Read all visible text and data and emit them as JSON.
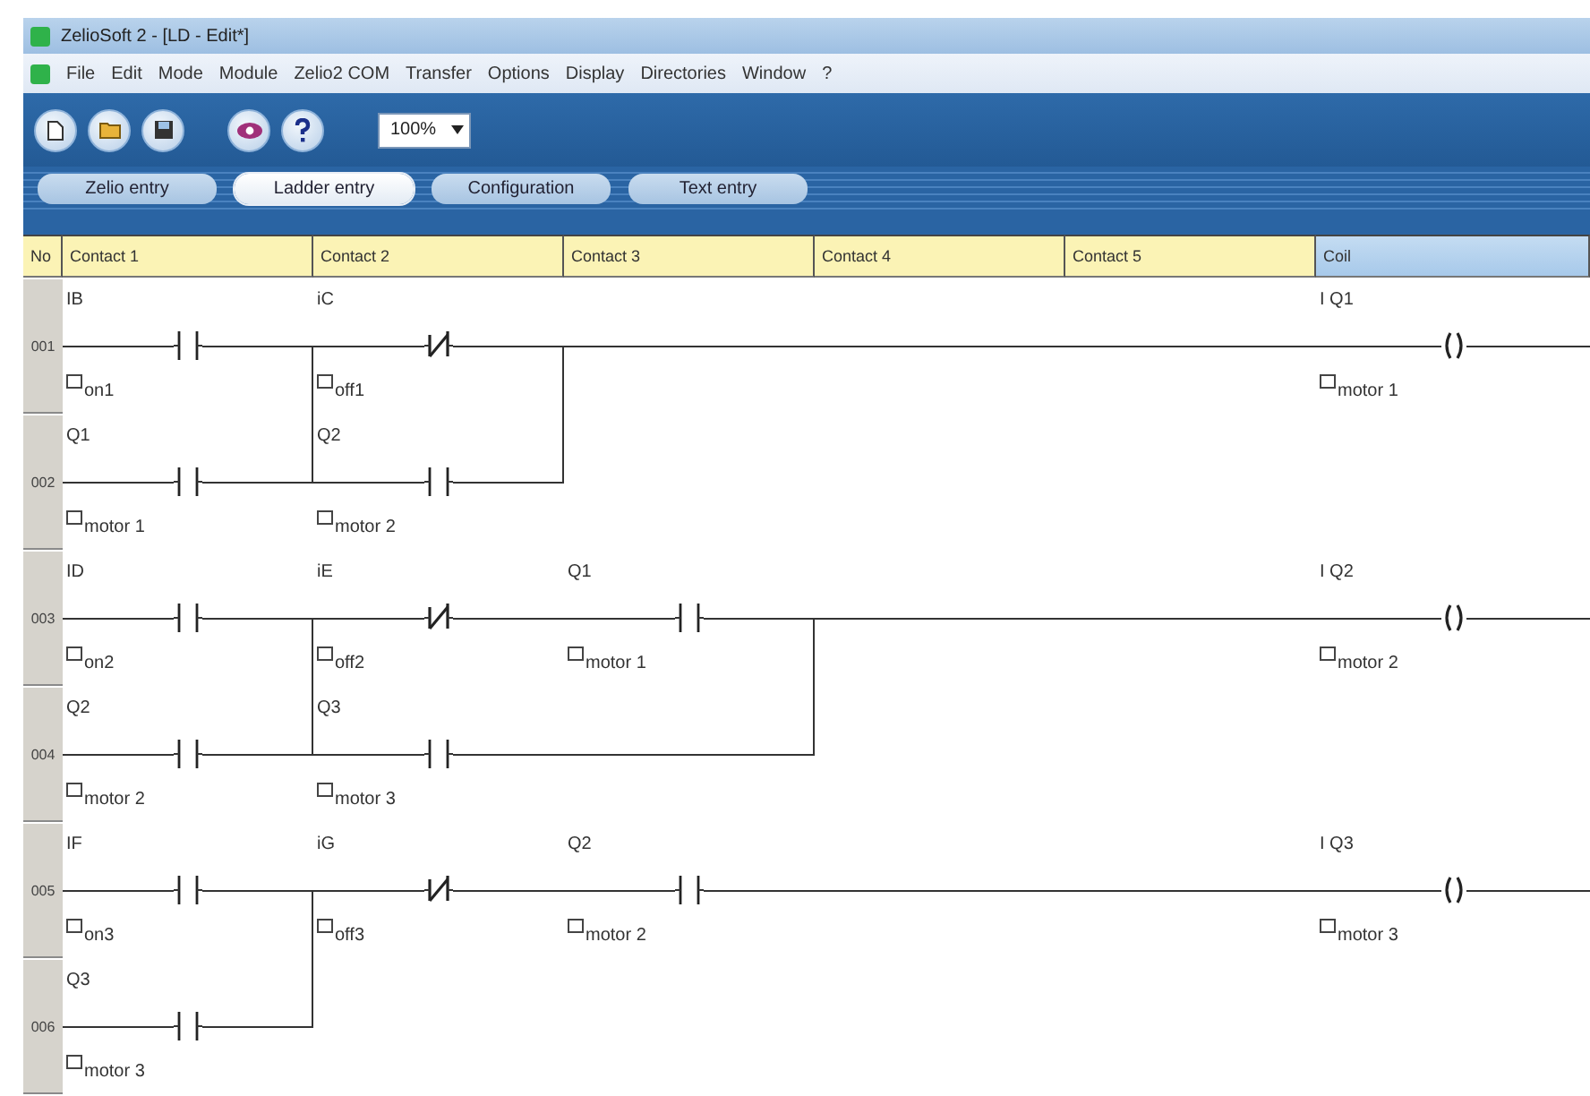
{
  "window": {
    "title": "ZelioSoft 2 - [LD - Edit*]"
  },
  "menu": [
    "File",
    "Edit",
    "Mode",
    "Module",
    "Zelio2 COM",
    "Transfer",
    "Options",
    "Display",
    "Directories",
    "Window",
    "?"
  ],
  "toolbar": {
    "zoom": "100%"
  },
  "tabs": [
    {
      "label": "Zelio entry",
      "selected": false
    },
    {
      "label": "Ladder entry",
      "selected": true
    },
    {
      "label": "Configuration",
      "selected": false
    },
    {
      "label": "Text entry",
      "selected": false
    }
  ],
  "columns": [
    {
      "label": "No",
      "selected": false
    },
    {
      "label": "Contact 1",
      "selected": false
    },
    {
      "label": "Contact 2",
      "selected": false
    },
    {
      "label": "Contact 3",
      "selected": false
    },
    {
      "label": "Contact 4",
      "selected": false
    },
    {
      "label": "Contact 5",
      "selected": false
    },
    {
      "label": "Coil",
      "selected": true
    }
  ],
  "rows": [
    {
      "number": "001",
      "cells": [
        {
          "kind": "no",
          "address": "IB",
          "comment": "on1"
        },
        {
          "kind": "nc",
          "address": "iC",
          "comment": "off1"
        },
        {
          "kind": "wire"
        },
        {
          "kind": "wire"
        },
        {
          "kind": "wire"
        },
        {
          "kind": "coil",
          "address": "I Q1",
          "comment": "motor 1"
        }
      ]
    },
    {
      "number": "002",
      "cells": [
        {
          "kind": "no",
          "address": "Q1",
          "comment": "motor 1",
          "link_up": true
        },
        {
          "kind": "no",
          "address": "Q2",
          "comment": "motor 2",
          "link_up": true
        },
        {
          "kind": "empty"
        },
        {
          "kind": "empty"
        },
        {
          "kind": "empty"
        },
        {
          "kind": "empty"
        }
      ]
    },
    {
      "number": "003",
      "cells": [
        {
          "kind": "no",
          "address": "ID",
          "comment": "on2"
        },
        {
          "kind": "nc",
          "address": "iE",
          "comment": "off2"
        },
        {
          "kind": "no",
          "address": "Q1",
          "comment": "motor 1"
        },
        {
          "kind": "wire"
        },
        {
          "kind": "wire"
        },
        {
          "kind": "coil",
          "address": "I Q2",
          "comment": "motor 2"
        }
      ]
    },
    {
      "number": "004",
      "cells": [
        {
          "kind": "no",
          "address": "Q2",
          "comment": "motor 2",
          "link_up": true
        },
        {
          "kind": "no",
          "address": "Q3",
          "comment": "motor 3"
        },
        {
          "kind": "wire",
          "link_up": true
        },
        {
          "kind": "empty"
        },
        {
          "kind": "empty"
        },
        {
          "kind": "empty"
        }
      ]
    },
    {
      "number": "005",
      "cells": [
        {
          "kind": "no",
          "address": "IF",
          "comment": "on3"
        },
        {
          "kind": "nc",
          "address": "iG",
          "comment": "off3"
        },
        {
          "kind": "no",
          "address": "Q2",
          "comment": "motor 2"
        },
        {
          "kind": "wire"
        },
        {
          "kind": "wire"
        },
        {
          "kind": "coil",
          "address": "I Q3",
          "comment": "motor 3"
        }
      ]
    },
    {
      "number": "006",
      "cells": [
        {
          "kind": "no",
          "address": "Q3",
          "comment": "motor 3",
          "link_up": true
        },
        {
          "kind": "empty"
        },
        {
          "kind": "empty"
        },
        {
          "kind": "empty"
        },
        {
          "kind": "empty"
        },
        {
          "kind": "empty"
        }
      ]
    }
  ]
}
